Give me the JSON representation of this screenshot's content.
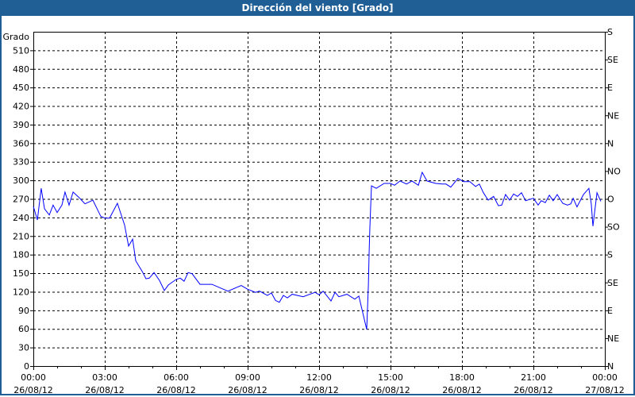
{
  "chart_data": {
    "type": "line",
    "title": "Dirección del viento [Grado]",
    "ylabel": "Grado",
    "ylim": [
      0,
      540
    ],
    "xlim": [
      0,
      24
    ],
    "y_ticks": [
      0,
      30,
      60,
      90,
      120,
      150,
      180,
      210,
      240,
      270,
      300,
      330,
      360,
      390,
      420,
      450,
      480,
      510
    ],
    "right_axis_ticks": [
      {
        "value": 540,
        "label": "S"
      },
      {
        "value": 495,
        "label": "SE"
      },
      {
        "value": 450,
        "label": "E"
      },
      {
        "value": 405,
        "label": "NE"
      },
      {
        "value": 360,
        "label": "N"
      },
      {
        "value": 315,
        "label": "NO"
      },
      {
        "value": 270,
        "label": "O"
      },
      {
        "value": 225,
        "label": "SO"
      },
      {
        "value": 180,
        "label": "S"
      },
      {
        "value": 135,
        "label": "SE"
      },
      {
        "value": 90,
        "label": "E"
      },
      {
        "value": 45,
        "label": "NE"
      },
      {
        "value": 0,
        "label": "N"
      }
    ],
    "x_ticks": [
      {
        "hour": 0,
        "time": "00:00",
        "date": "26/08/12"
      },
      {
        "hour": 3,
        "time": "03:00",
        "date": "26/08/12"
      },
      {
        "hour": 6,
        "time": "06:00",
        "date": "26/08/12"
      },
      {
        "hour": 9,
        "time": "09:00",
        "date": "26/08/12"
      },
      {
        "hour": 12,
        "time": "12:00",
        "date": "26/08/12"
      },
      {
        "hour": 15,
        "time": "15:00",
        "date": "26/08/12"
      },
      {
        "hour": 18,
        "time": "18:00",
        "date": "26/08/12"
      },
      {
        "hour": 21,
        "time": "21:00",
        "date": "26/08/12"
      },
      {
        "hour": 24,
        "time": "00:00",
        "date": "27/08/12"
      }
    ],
    "grid": true,
    "series": [
      {
        "name": "Dirección del viento",
        "color": "#0000ff",
        "points": [
          [
            0,
            258
          ],
          [
            0.17,
            236
          ],
          [
            0.33,
            287
          ],
          [
            0.47,
            254
          ],
          [
            0.67,
            244
          ],
          [
            0.83,
            260
          ],
          [
            1.0,
            248
          ],
          [
            1.2,
            260
          ],
          [
            1.33,
            281
          ],
          [
            1.5,
            260
          ],
          [
            1.67,
            281
          ],
          [
            1.9,
            273
          ],
          [
            2.17,
            262
          ],
          [
            2.5,
            268
          ],
          [
            2.83,
            242
          ],
          [
            3.0,
            239
          ],
          [
            3.2,
            239
          ],
          [
            3.53,
            263
          ],
          [
            3.83,
            228
          ],
          [
            4.0,
            194
          ],
          [
            4.17,
            205
          ],
          [
            4.3,
            170
          ],
          [
            4.57,
            153
          ],
          [
            4.73,
            141
          ],
          [
            4.87,
            142
          ],
          [
            5.07,
            151
          ],
          [
            5.3,
            138
          ],
          [
            5.5,
            122
          ],
          [
            5.67,
            131
          ],
          [
            6.0,
            140
          ],
          [
            6.17,
            142
          ],
          [
            6.33,
            137
          ],
          [
            6.5,
            151
          ],
          [
            6.67,
            149
          ],
          [
            7.0,
            132
          ],
          [
            7.5,
            132
          ],
          [
            8.17,
            121
          ],
          [
            8.73,
            130
          ],
          [
            9.0,
            124
          ],
          [
            9.33,
            119
          ],
          [
            9.5,
            121
          ],
          [
            9.83,
            114
          ],
          [
            10.0,
            118
          ],
          [
            10.17,
            106
          ],
          [
            10.33,
            103
          ],
          [
            10.5,
            114
          ],
          [
            10.67,
            110
          ],
          [
            10.87,
            116
          ],
          [
            11.33,
            112
          ],
          [
            11.83,
            119
          ],
          [
            12.0,
            115
          ],
          [
            12.17,
            121
          ],
          [
            12.5,
            105
          ],
          [
            12.67,
            119
          ],
          [
            12.83,
            112
          ],
          [
            13.17,
            116
          ],
          [
            13.5,
            108
          ],
          [
            13.67,
            113
          ],
          [
            14.0,
            59
          ],
          [
            14.07,
            130
          ],
          [
            14.1,
            181
          ],
          [
            14.13,
            221
          ],
          [
            14.2,
            291
          ],
          [
            14.4,
            287
          ],
          [
            14.73,
            295
          ],
          [
            15.0,
            295
          ],
          [
            15.17,
            292
          ],
          [
            15.4,
            299
          ],
          [
            15.67,
            294
          ],
          [
            15.9,
            299
          ],
          [
            16.17,
            292
          ],
          [
            16.33,
            313
          ],
          [
            16.53,
            299
          ],
          [
            16.9,
            295
          ],
          [
            17.17,
            294
          ],
          [
            17.33,
            294
          ],
          [
            17.53,
            289
          ],
          [
            17.83,
            303
          ],
          [
            18.07,
            298
          ],
          [
            18.33,
            298
          ],
          [
            18.57,
            290
          ],
          [
            18.73,
            294
          ],
          [
            18.9,
            280
          ],
          [
            19.1,
            268
          ],
          [
            19.33,
            274
          ],
          [
            19.53,
            259
          ],
          [
            19.67,
            260
          ],
          [
            19.83,
            277
          ],
          [
            20.0,
            268
          ],
          [
            20.17,
            278
          ],
          [
            20.33,
            274
          ],
          [
            20.5,
            280
          ],
          [
            20.67,
            267
          ],
          [
            21.0,
            271
          ],
          [
            21.2,
            260
          ],
          [
            21.33,
            267
          ],
          [
            21.5,
            264
          ],
          [
            21.67,
            276
          ],
          [
            21.83,
            267
          ],
          [
            22.0,
            277
          ],
          [
            22.23,
            263
          ],
          [
            22.43,
            260
          ],
          [
            22.57,
            262
          ],
          [
            22.67,
            271
          ],
          [
            22.83,
            257
          ],
          [
            23.1,
            277
          ],
          [
            23.33,
            287
          ],
          [
            23.43,
            262
          ],
          [
            23.5,
            226
          ],
          [
            23.67,
            280
          ],
          [
            23.83,
            266
          ]
        ]
      }
    ]
  }
}
